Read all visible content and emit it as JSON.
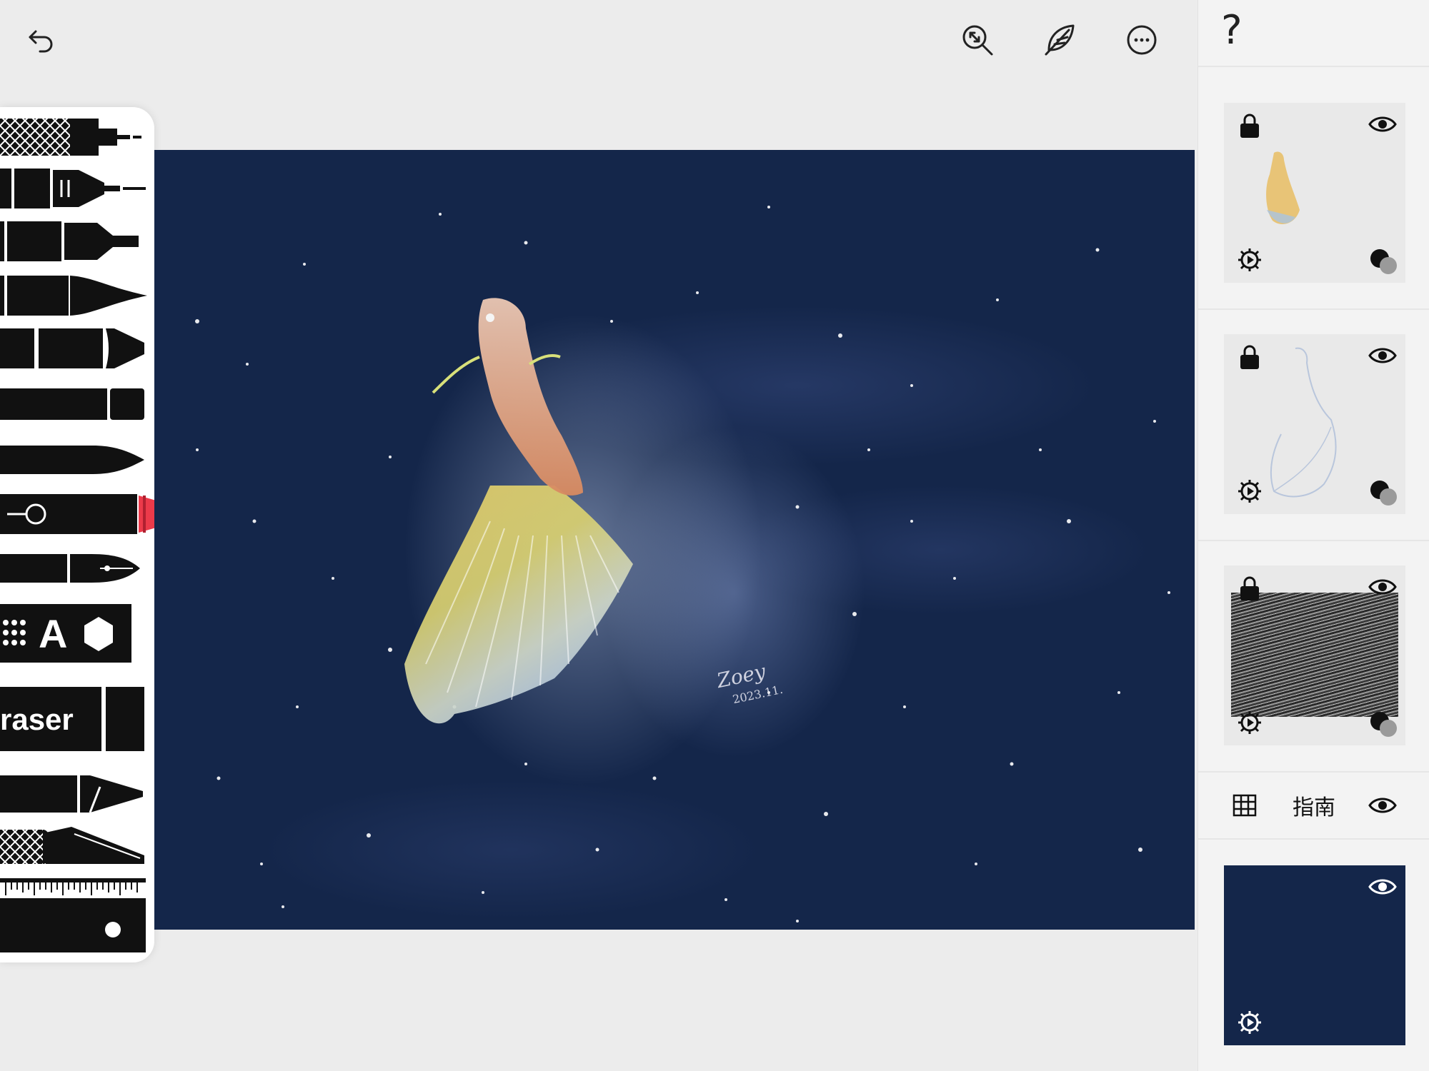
{
  "topbar": {
    "undo_icon": "undo-arrow-icon",
    "zoom_icon": "zoom-fit-icon",
    "brush_icon": "feather-quill-icon",
    "more_icon": "more-ellipsis-icon"
  },
  "tools": {
    "text_tool_letter": "A",
    "eraser_label": "raser",
    "selected_color": "#ec3a4a"
  },
  "canvas": {
    "background_color": "#14264a",
    "signature_name": "Zoey",
    "signature_date": "2023.11."
  },
  "rightpanel": {
    "help_label": "?",
    "guide_label": "指南",
    "layers": [
      {
        "type": "fish-color-layer",
        "locked": true,
        "visible": true
      },
      {
        "type": "fish-line-layer",
        "locked": true,
        "visible": true
      },
      {
        "type": "texture-layer",
        "locked": true,
        "visible": true
      },
      {
        "type": "background-layer",
        "visible": true,
        "color": "#14264a"
      }
    ]
  }
}
